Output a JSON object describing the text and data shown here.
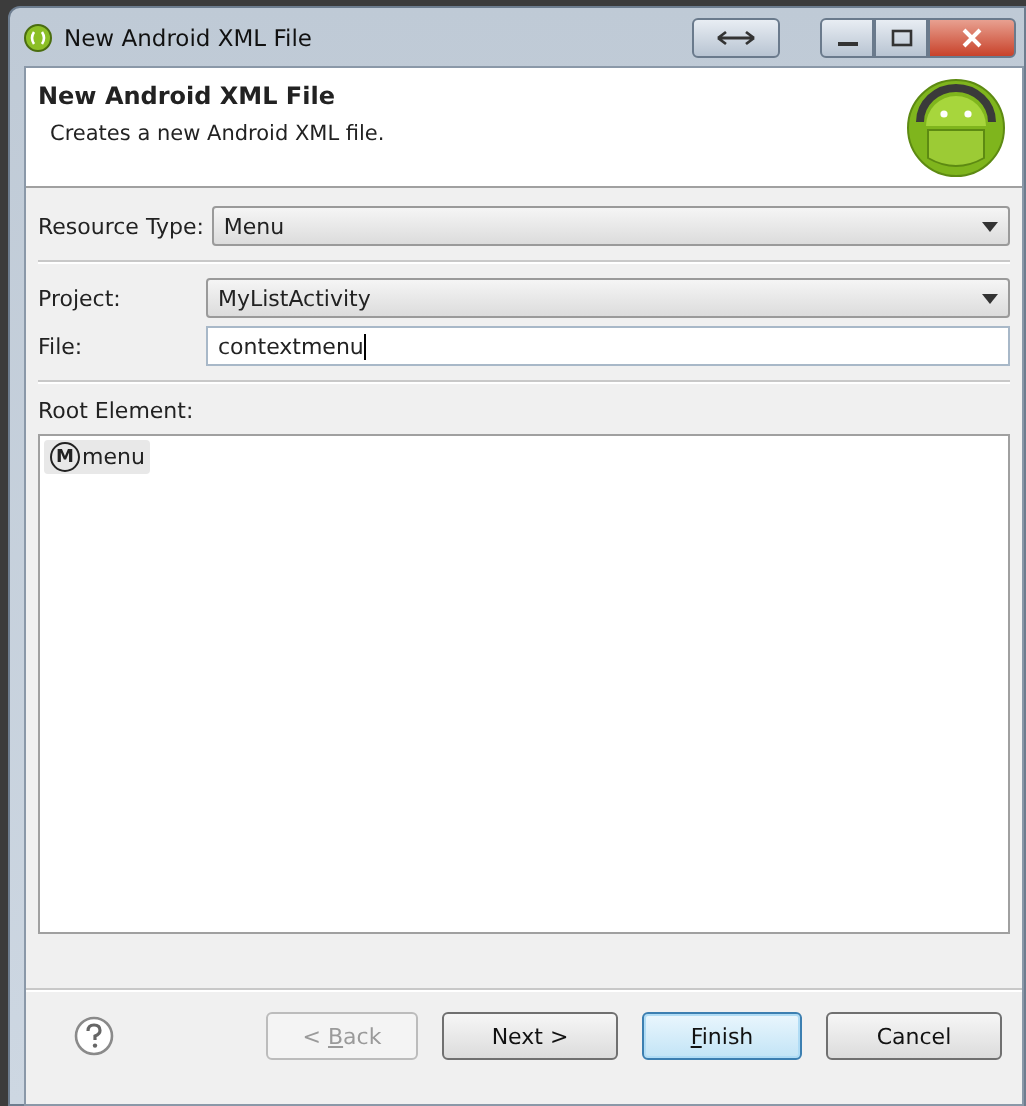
{
  "window": {
    "title": "New Android XML File"
  },
  "header": {
    "title": "New Android XML File",
    "description": "Creates a new Android XML file."
  },
  "resource_type": {
    "label": "Resource Type:",
    "value": "Menu"
  },
  "project": {
    "label": "Project:",
    "value": "MyListActivity"
  },
  "file": {
    "label": "File:",
    "value": "contextmenu"
  },
  "root_element": {
    "label": "Root Element:",
    "items": [
      {
        "badge": "M",
        "name": "menu",
        "selected": true
      }
    ]
  },
  "buttons": [
    {
      "kind": "back",
      "before": "< ",
      "mnemonic": "B",
      "after": "ack",
      "disabled": true,
      "default": false
    },
    {
      "kind": "next",
      "before": "Next >",
      "disabled": false,
      "default": false
    },
    {
      "kind": "finish",
      "mnemonic": "F",
      "after": "inish",
      "disabled": false,
      "default": true
    },
    {
      "kind": "cancel",
      "before": "Cancel",
      "disabled": false,
      "default": false
    }
  ]
}
